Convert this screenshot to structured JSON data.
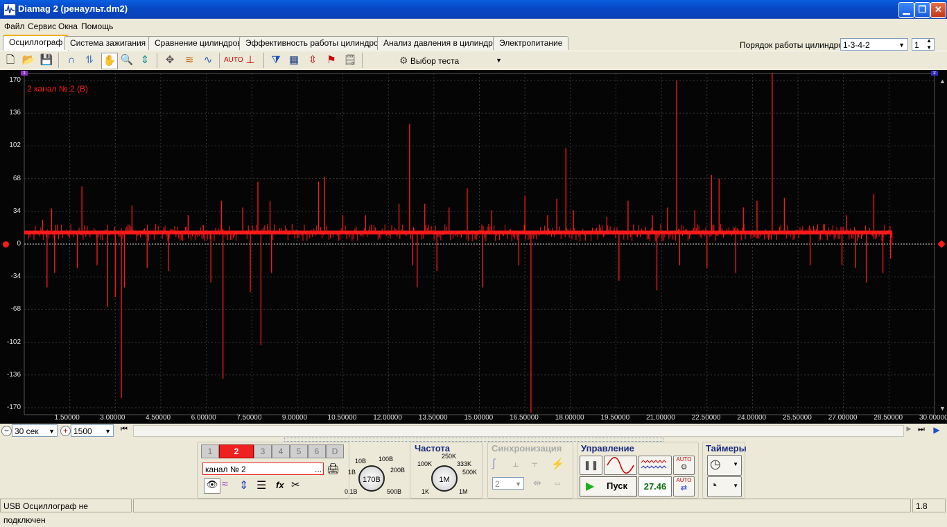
{
  "window": {
    "title": "Diamag 2 (ренаульт.dm2)"
  },
  "menu": [
    "Файл",
    "Сервис",
    "Окна",
    "Помощь"
  ],
  "cylinder_order": {
    "label": "Порядок работы цилиндров",
    "value": "1-3-4-2",
    "spin_value": "1"
  },
  "tabs": [
    "Осциллограф",
    "Система зажигания",
    "Сравнение цилиндров",
    "Эффективность работы цилиндров",
    "Анализ давления в цилиндре",
    "Электропитание"
  ],
  "toolbar": {
    "test_select": "Выбор теста"
  },
  "scope": {
    "channel_label": "2  канал № 2 (В)",
    "marker_left": "1",
    "marker_right": "2",
    "y_ticks": [
      "170",
      "136",
      "102",
      "68",
      "34",
      "0",
      "-34",
      "-68",
      "-102",
      "-136",
      "-170"
    ],
    "x_ticks": [
      "1.50000",
      "3.00000",
      "4.50000",
      "6.00000",
      "7.50000",
      "9.00000",
      "10.50000",
      "12.00000",
      "13.50000",
      "15.00000",
      "16.50000",
      "18.00000",
      "19.50000",
      "21.00000",
      "22.50000",
      "24.00000",
      "25.50000",
      "27.00000",
      "28.50000",
      "30.00000"
    ],
    "colors": {
      "trace": "#ff1a1a",
      "background": "#050505",
      "grid": "#3a3a3a"
    }
  },
  "scroll": {
    "time_value": "30 сек",
    "points_value": "1500"
  },
  "channels": {
    "buttons": [
      "1",
      "2",
      "3",
      "4",
      "5",
      "6",
      "D"
    ],
    "active": "2",
    "name_value": "канал № 2",
    "name_more": "...",
    "range_dial": {
      "labels": [
        "10В",
        "100В",
        "1В",
        "200В",
        "0.1В",
        "500В"
      ],
      "value": "170В"
    }
  },
  "frequency": {
    "title": "Частота",
    "labels": [
      "250K",
      "100K",
      "333K",
      "500K",
      "1K",
      "1M"
    ],
    "value": "1M"
  },
  "sync": {
    "title": "Синхронизация",
    "value": "2"
  },
  "control": {
    "title": "Управление",
    "start_label": "Пуск",
    "value": "27.46",
    "auto1": "AUTO",
    "auto2": "AUTO"
  },
  "timers": {
    "title": "Таймеры"
  },
  "status": {
    "left": "USB Осциллограф не подключен",
    "right": "1.8"
  },
  "chart_data": {
    "type": "line",
    "title": "",
    "xlabel": "",
    "ylabel": "",
    "xlim": [
      0,
      30
    ],
    "ylim": [
      -170,
      170
    ],
    "baseline": 12,
    "trace_end_x": 28.6,
    "spikes": [
      {
        "x": 0.6,
        "y": 25
      },
      {
        "x": 0.75,
        "y": -45
      },
      {
        "x": 0.9,
        "y": 37
      },
      {
        "x": 1.0,
        "y": -30
      },
      {
        "x": 1.9,
        "y": 60
      },
      {
        "x": 1.75,
        "y": -25
      },
      {
        "x": 2.4,
        "y": -22
      },
      {
        "x": 2.75,
        "y": -65
      },
      {
        "x": 3.0,
        "y": -55
      },
      {
        "x": 3.2,
        "y": -160
      },
      {
        "x": 3.3,
        "y": -45
      },
      {
        "x": 3.55,
        "y": 40
      },
      {
        "x": 4.05,
        "y": -25
      },
      {
        "x": 4.75,
        "y": -28
      },
      {
        "x": 5.4,
        "y": 30
      },
      {
        "x": 5.9,
        "y": 20
      },
      {
        "x": 6.15,
        "y": -40
      },
      {
        "x": 6.5,
        "y": 45
      },
      {
        "x": 6.55,
        "y": -140
      },
      {
        "x": 7.2,
        "y": 38
      },
      {
        "x": 7.45,
        "y": -50
      },
      {
        "x": 7.7,
        "y": 65
      },
      {
        "x": 7.8,
        "y": -105
      },
      {
        "x": 8.1,
        "y": 45
      },
      {
        "x": 8.15,
        "y": -30
      },
      {
        "x": 9.7,
        "y": 65
      },
      {
        "x": 9.9,
        "y": 70
      },
      {
        "x": 10.5,
        "y": 30
      },
      {
        "x": 11.25,
        "y": 30
      },
      {
        "x": 12.35,
        "y": 42
      },
      {
        "x": 12.8,
        "y": -22
      },
      {
        "x": 12.7,
        "y": 125
      },
      {
        "x": 12.95,
        "y": -45
      },
      {
        "x": 13.2,
        "y": 42
      },
      {
        "x": 13.6,
        "y": -28
      },
      {
        "x": 14.0,
        "y": 38
      },
      {
        "x": 14.6,
        "y": 58
      },
      {
        "x": 15.1,
        "y": -45
      },
      {
        "x": 15.4,
        "y": 35
      },
      {
        "x": 16.3,
        "y": -22
      },
      {
        "x": 16.5,
        "y": 50
      },
      {
        "x": 16.7,
        "y": -175
      },
      {
        "x": 17.25,
        "y": 30
      },
      {
        "x": 17.55,
        "y": 47
      },
      {
        "x": 17.85,
        "y": 100
      },
      {
        "x": 18.1,
        "y": 35
      },
      {
        "x": 19.2,
        "y": 28
      },
      {
        "x": 19.6,
        "y": -38
      },
      {
        "x": 19.9,
        "y": 45
      },
      {
        "x": 20.7,
        "y": 30
      },
      {
        "x": 20.85,
        "y": -48
      },
      {
        "x": 21.2,
        "y": 38
      },
      {
        "x": 21.5,
        "y": 170
      },
      {
        "x": 21.6,
        "y": -22
      },
      {
        "x": 22.1,
        "y": 35
      },
      {
        "x": 22.5,
        "y": -25
      },
      {
        "x": 22.65,
        "y": 72
      },
      {
        "x": 22.9,
        "y": 68
      },
      {
        "x": 23.45,
        "y": -30
      },
      {
        "x": 23.7,
        "y": 38
      },
      {
        "x": 24.15,
        "y": 45
      },
      {
        "x": 24.65,
        "y": 178
      },
      {
        "x": 25.05,
        "y": 48
      },
      {
        "x": 25.9,
        "y": -22
      },
      {
        "x": 26.95,
        "y": -22
      },
      {
        "x": 27.4,
        "y": -25
      },
      {
        "x": 27.75,
        "y": -40
      },
      {
        "x": 28.0,
        "y": 52
      },
      {
        "x": 28.3,
        "y": -30
      },
      {
        "x": 27.1,
        "y": 30
      },
      {
        "x": 28.55,
        "y": -15
      }
    ]
  }
}
